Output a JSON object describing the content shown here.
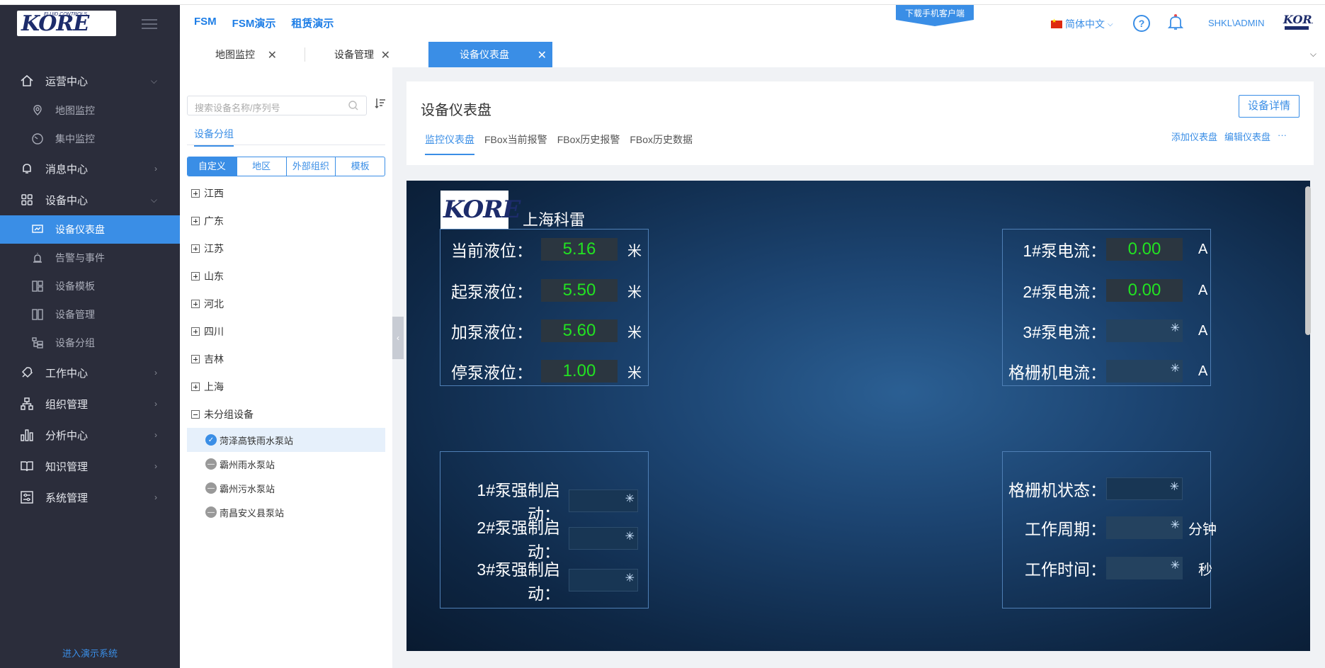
{
  "sidebar": {
    "menu": [
      {
        "label": "运营中心",
        "icon": "home-icon",
        "expanded": true,
        "children": [
          {
            "label": "地图监控",
            "icon": "map-pin-icon"
          },
          {
            "label": "集中监控",
            "icon": "gauge-icon"
          }
        ]
      },
      {
        "label": "消息中心",
        "icon": "bell-icon"
      },
      {
        "label": "设备中心",
        "icon": "grid-icon",
        "expanded": true,
        "children": [
          {
            "label": "设备仪表盘",
            "icon": "dashboard-icon",
            "active": true
          },
          {
            "label": "告警与事件",
            "icon": "alarm-icon"
          },
          {
            "label": "设备模板",
            "icon": "template-icon"
          },
          {
            "label": "设备管理",
            "icon": "device-icon"
          },
          {
            "label": "设备分组",
            "icon": "group-icon"
          }
        ]
      },
      {
        "label": "工作中心",
        "icon": "wrench-icon"
      },
      {
        "label": "组织管理",
        "icon": "org-icon"
      },
      {
        "label": "分析中心",
        "icon": "bar-chart-icon"
      },
      {
        "label": "知识管理",
        "icon": "book-icon"
      },
      {
        "label": "系统管理",
        "icon": "settings-icon"
      }
    ],
    "demo_link": "进入演示系统"
  },
  "header": {
    "links": [
      "FSM",
      "FSM演示",
      "租赁演示"
    ],
    "download_banner": "下载手机客户端",
    "language": "简体中文",
    "user": "SHKL\\ADMIN"
  },
  "tabs": [
    {
      "label": "地图监控",
      "active": false
    },
    {
      "label": "设备管理",
      "active": false
    },
    {
      "label": "设备仪表盘",
      "active": true
    }
  ],
  "left_panel": {
    "search_placeholder": "搜索设备名称/序列号",
    "group_tab": "设备分组",
    "segments": [
      "自定义",
      "地区",
      "外部组织",
      "模板"
    ],
    "active_segment": "自定义",
    "tree": [
      {
        "label": "江西",
        "expanded": false
      },
      {
        "label": "广东",
        "expanded": false
      },
      {
        "label": "江苏",
        "expanded": false
      },
      {
        "label": "山东",
        "expanded": false
      },
      {
        "label": "河北",
        "expanded": false
      },
      {
        "label": "四川",
        "expanded": false
      },
      {
        "label": "吉林",
        "expanded": false
      },
      {
        "label": "上海",
        "expanded": false
      },
      {
        "label": "未分组设备",
        "expanded": true
      }
    ],
    "devices": [
      {
        "label": "菏泽高铁雨水泵站",
        "status": "online",
        "selected": true
      },
      {
        "label": "霸州雨水泵站",
        "status": "offline"
      },
      {
        "label": "霸州污水泵站",
        "status": "offline"
      },
      {
        "label": "南昌安义县泵站",
        "status": "offline"
      }
    ]
  },
  "main": {
    "title": "设备仪表盘",
    "detail_button": "设备详情",
    "subtabs": [
      "监控仪表盘",
      "FBox当前报警",
      "FBox历史报警",
      "FBox历史数据"
    ],
    "active_subtab": "监控仪表盘",
    "actions": [
      "添加仪表盘",
      "编辑仪表盘",
      "···"
    ]
  },
  "dashboard": {
    "company": "上海科雷",
    "levels": [
      {
        "label": "当前液位：",
        "value": "5.16",
        "unit": "米"
      },
      {
        "label": "起泵液位：",
        "value": "5.50",
        "unit": "米"
      },
      {
        "label": "加泵液位：",
        "value": "5.60",
        "unit": "米"
      },
      {
        "label": "停泵液位：",
        "value": "1.00",
        "unit": "米"
      }
    ],
    "currents": [
      {
        "label": "1#泵电流：",
        "value": "0.00",
        "unit": "A"
      },
      {
        "label": "2#泵电流：",
        "value": "0.00",
        "unit": "A"
      },
      {
        "label": "3#泵电流：",
        "value": "",
        "unit": "A"
      },
      {
        "label": "格栅机电流：",
        "value": "",
        "unit": "A"
      }
    ],
    "force": [
      {
        "label": "1#泵强制启动："
      },
      {
        "label": "2#泵强制启动："
      },
      {
        "label": "3#泵强制启动："
      }
    ],
    "grille": [
      {
        "label": "格栅机状态：",
        "unit": ""
      },
      {
        "label": "工作周期：",
        "unit": "分钟"
      },
      {
        "label": "工作时间：",
        "unit": "秒"
      }
    ]
  }
}
